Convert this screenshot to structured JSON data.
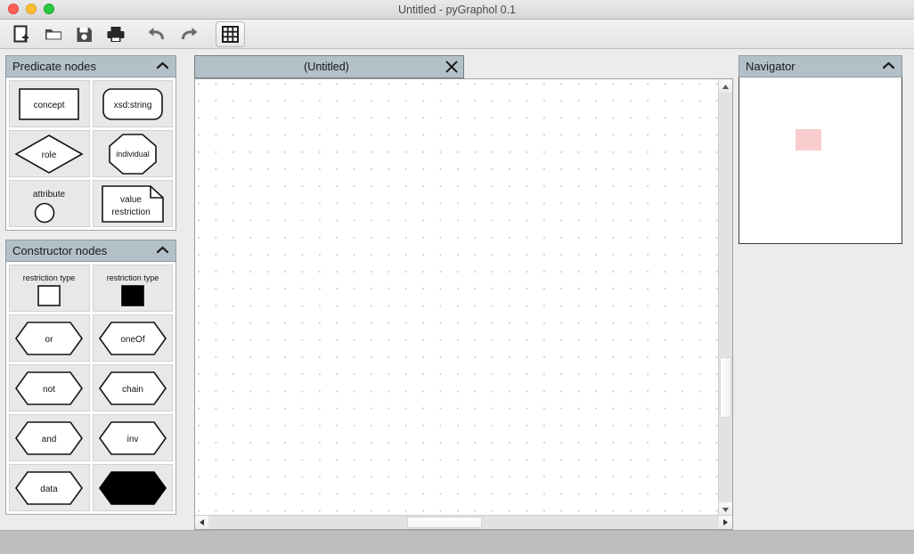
{
  "window": {
    "title": "Untitled - pyGraphol 0.1",
    "traffic_lights": [
      {
        "name": "close",
        "color": "#ff5f57"
      },
      {
        "name": "minimize",
        "color": "#ffbd2e"
      },
      {
        "name": "zoom",
        "color": "#28c840"
      }
    ]
  },
  "toolbar": {
    "buttons": [
      {
        "icon": "new-document-icon",
        "label": "New"
      },
      {
        "icon": "open-folder-icon",
        "label": "Open"
      },
      {
        "icon": "save-floppy-icon",
        "label": "Save"
      },
      {
        "icon": "print-icon",
        "label": "Print"
      },
      {
        "icon": "undo-arrow-icon",
        "label": "Undo"
      },
      {
        "icon": "redo-arrow-icon",
        "label": "Redo"
      },
      {
        "icon": "grid-icon",
        "label": "Toggle Grid",
        "active": true
      }
    ]
  },
  "sidebar": {
    "panels": [
      {
        "title": "Predicate nodes",
        "collapse_icon": "chevron-up-icon",
        "nodes": [
          {
            "label": "concept",
            "shape": "rectangle",
            "fill": "#ffffff"
          },
          {
            "label": "xsd:string",
            "shape": "rounded-rectangle",
            "fill": "#ffffff"
          },
          {
            "label": "role",
            "shape": "diamond",
            "fill": "#ffffff"
          },
          {
            "label": "individual",
            "shape": "octagon",
            "fill": "#ffffff"
          },
          {
            "label": "attribute",
            "shape": "circle",
            "fill": "#ffffff"
          },
          {
            "label": "value restriction",
            "shape": "note",
            "fill": "#ffffff"
          }
        ]
      },
      {
        "title": "Constructor nodes",
        "collapse_icon": "chevron-up-icon",
        "nodes": [
          {
            "label": "restriction type",
            "shape": "square",
            "fill": "#ffffff"
          },
          {
            "label": "restriction type",
            "shape": "square",
            "fill": "#000000"
          },
          {
            "label": "or",
            "shape": "hexagon",
            "fill": "#ffffff"
          },
          {
            "label": "oneOf",
            "shape": "hexagon",
            "fill": "#ffffff"
          },
          {
            "label": "not",
            "shape": "hexagon",
            "fill": "#ffffff"
          },
          {
            "label": "chain",
            "shape": "hexagon",
            "fill": "#ffffff"
          },
          {
            "label": "and",
            "shape": "hexagon",
            "fill": "#ffffff"
          },
          {
            "label": "inv",
            "shape": "hexagon",
            "fill": "#ffffff"
          },
          {
            "label": "data",
            "shape": "hexagon",
            "fill": "#ffffff"
          },
          {
            "label": "",
            "shape": "hexagon",
            "fill": "#000000"
          }
        ]
      }
    ]
  },
  "workspace": {
    "tab": {
      "label": "(Untitled)",
      "close_icon": "close-x-icon"
    },
    "canvas": {
      "background": "#ffffff",
      "grid_dot_color": "#d0d0d0",
      "grid_enabled": true
    },
    "scrollbars": {
      "vertical": {
        "up_icon": "triangle-up-icon",
        "down_icon": "triangle-down-icon"
      },
      "horizontal": {
        "left_icon": "triangle-left-icon",
        "right_icon": "triangle-right-icon"
      }
    }
  },
  "navigator": {
    "title": "Navigator",
    "collapse_icon": "chevron-up-icon",
    "viewport_color": "#f9cdcd"
  }
}
